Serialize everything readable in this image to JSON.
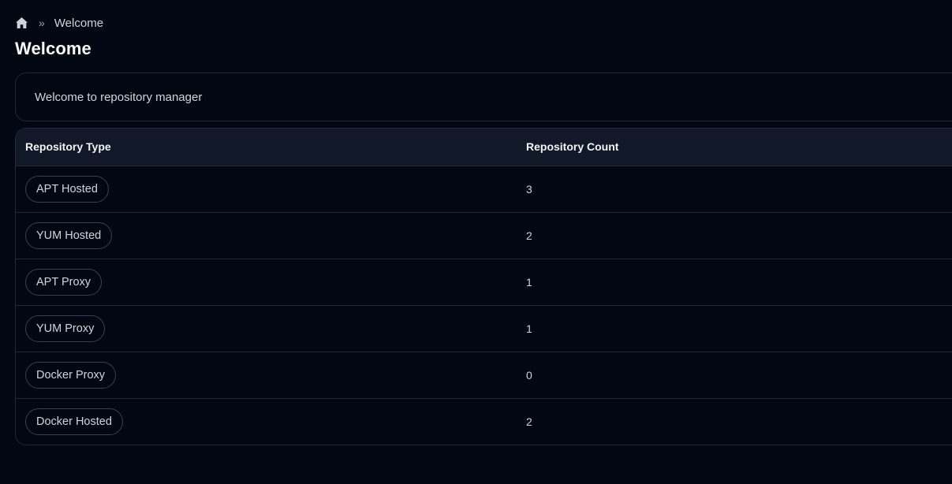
{
  "breadcrumb": {
    "home_icon": "home-icon",
    "separator": "»",
    "current": "Welcome"
  },
  "page_title": "Welcome",
  "welcome_message": "Welcome to repository manager",
  "table": {
    "headers": [
      "Repository Type",
      "Repository Count"
    ],
    "rows": [
      {
        "type": "APT Hosted",
        "count": "3"
      },
      {
        "type": "YUM Hosted",
        "count": "2"
      },
      {
        "type": "APT Proxy",
        "count": "1"
      },
      {
        "type": "YUM Proxy",
        "count": "1"
      },
      {
        "type": "Docker Proxy",
        "count": "0"
      },
      {
        "type": "Docker Hosted",
        "count": "2"
      }
    ]
  },
  "colors": {
    "background": "#030712",
    "header_bg": "#111827",
    "border": "#1f2937"
  }
}
